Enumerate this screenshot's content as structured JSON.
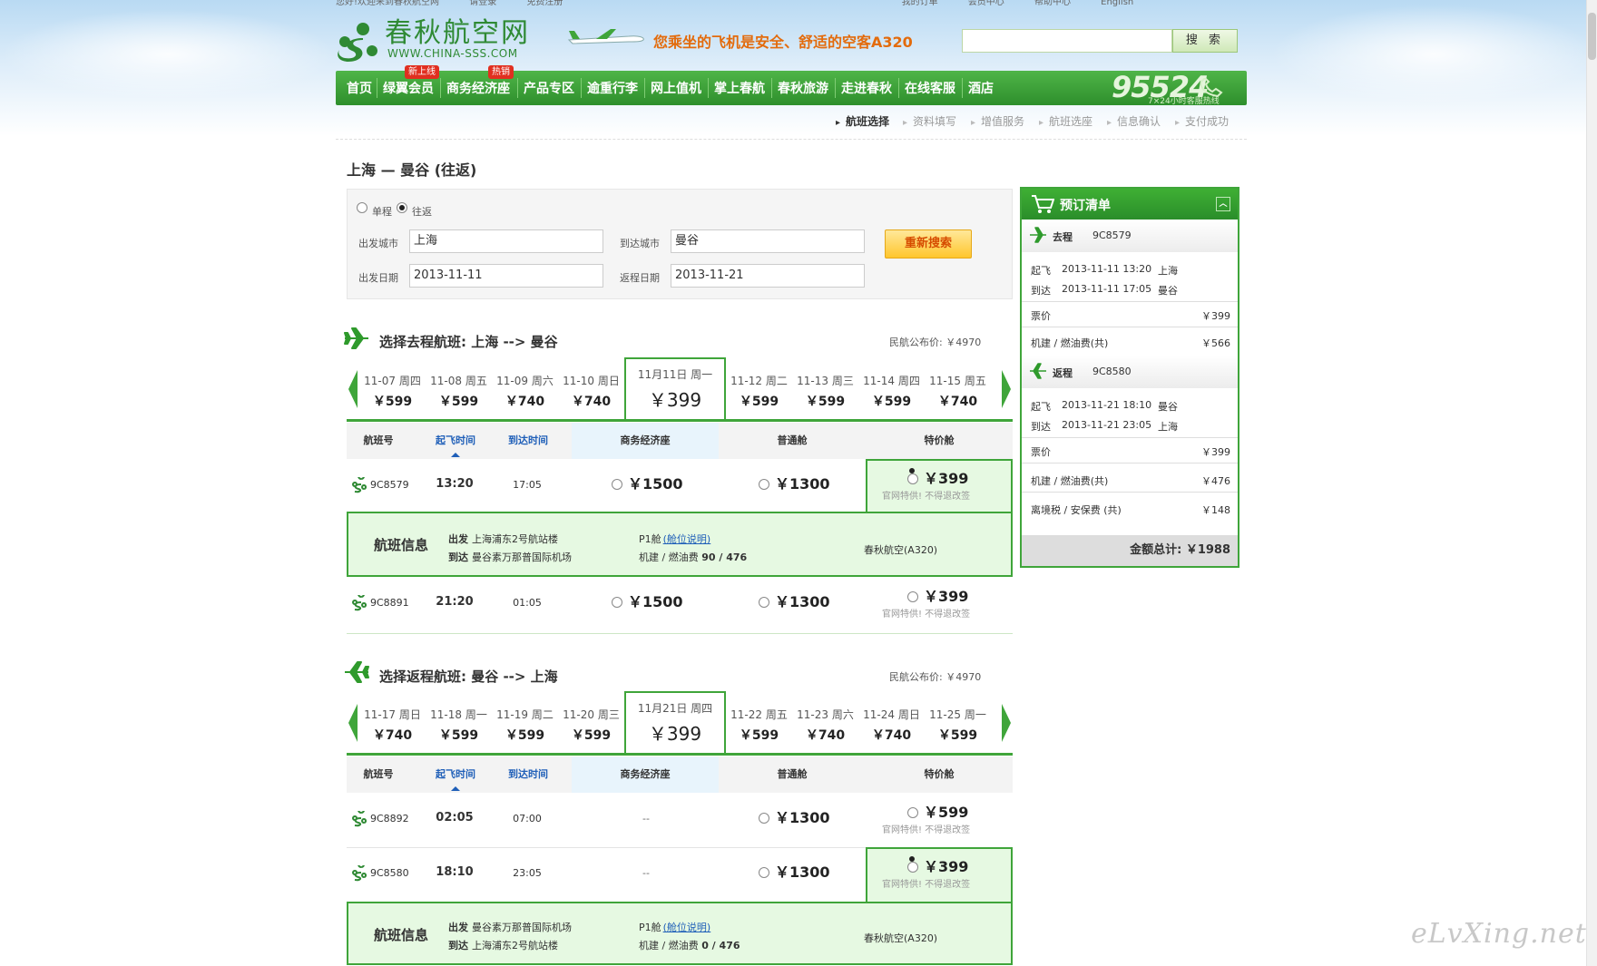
{
  "topbar": {
    "items": [
      "您好!欢迎来到春秋航空网",
      "请登录",
      "免费注册",
      "我的订单",
      "会员中心",
      "帮助中心",
      "English"
    ]
  },
  "logo": {
    "name": "春秋航空网",
    "url": "WWW.CHINA-SSS.COM"
  },
  "banner": {
    "text": "您乘坐的飞机是安全、舒适的空客A320"
  },
  "search": {
    "placeholder": "",
    "button": "搜 索"
  },
  "nav": {
    "items": [
      {
        "label": "首页",
        "badge": ""
      },
      {
        "label": "绿翼会员",
        "badge": "新上线"
      },
      {
        "label": "商务经济座",
        "badge": "热销"
      },
      {
        "label": "产品专区",
        "badge": ""
      },
      {
        "label": "逾重行李",
        "badge": ""
      },
      {
        "label": "网上值机",
        "badge": ""
      },
      {
        "label": "掌上春航",
        "badge": ""
      },
      {
        "label": "春秋旅游",
        "badge": ""
      },
      {
        "label": "走进春秋",
        "badge": ""
      },
      {
        "label": "在线客服",
        "badge": ""
      },
      {
        "label": "酒店",
        "badge": ""
      }
    ],
    "hotline": {
      "number": "95524",
      "subtitle": "7×24小时客服热线"
    }
  },
  "steps": [
    "航班选择",
    "资料填写",
    "增值服务",
    "航班选座",
    "信息确认",
    "支付成功"
  ],
  "route": {
    "title": "上海 — 曼谷 (往返)"
  },
  "search_form": {
    "trip_types": [
      "单程",
      "往返"
    ],
    "selected_trip": "往返",
    "depart_city_label": "出发城市",
    "depart_city": "上海",
    "arrive_city_label": "到达城市",
    "arrive_city": "曼谷",
    "depart_date_label": "出发日期",
    "depart_date": "2013-11-11",
    "return_date_label": "返程日期",
    "return_date": "2013-11-21",
    "research_button": "重新搜索"
  },
  "outbound": {
    "title": "选择去程航班: 上海 --> 曼谷",
    "published_price": "民航公布价: ￥4970",
    "dates": [
      {
        "date": "11-07 周四",
        "price": "￥599"
      },
      {
        "date": "11-08 周五",
        "price": "￥599"
      },
      {
        "date": "11-09 周六",
        "price": "￥740"
      },
      {
        "date": "11-10 周日",
        "price": "￥740"
      },
      {
        "date": "11月11日 周一",
        "price": "￥399",
        "selected": true
      },
      {
        "date": "11-12 周二",
        "price": "￥599"
      },
      {
        "date": "11-13 周三",
        "price": "￥599"
      },
      {
        "date": "11-14 周四",
        "price": "￥599"
      },
      {
        "date": "11-15 周五",
        "price": "￥740"
      }
    ],
    "flights": [
      {
        "flight_no": "9C8579",
        "dep": "13:20",
        "arr": "17:05",
        "business": "￥1500",
        "economy": "￥1300",
        "special": "￥399",
        "special_note": "官网特供! 不得退改签",
        "selected": "special"
      },
      {
        "flight_no": "9C8891",
        "dep": "21:20",
        "arr": "01:05",
        "business": "￥1500",
        "economy": "￥1300",
        "special": "￥399",
        "special_note": "官网特供! 不得退改签",
        "selected": ""
      }
    ],
    "info": {
      "title": "航班信息",
      "depart_label": "出发",
      "depart": "上海浦东2号航站楼",
      "arrive_label": "到达",
      "arrive": "曼谷素万那普国际机场",
      "cabin": "P1舱",
      "cabin_link": "(舱位说明)",
      "fee_label": "机建 / 燃油费",
      "fee": "90 / 476",
      "aircraft": "春秋航空(A320)"
    }
  },
  "table_headers": {
    "flight_no": "航班号",
    "dep": "起飞时间",
    "arr": "到达时间",
    "business": "商务经济座",
    "economy": "普通舱",
    "special": "特价舱"
  },
  "inbound": {
    "title": "选择返程航班: 曼谷 --> 上海",
    "published_price": "民航公布价: ￥4970",
    "dates": [
      {
        "date": "11-17 周日",
        "price": "￥740"
      },
      {
        "date": "11-18 周一",
        "price": "￥599"
      },
      {
        "date": "11-19 周二",
        "price": "￥599"
      },
      {
        "date": "11-20 周三",
        "price": "￥599"
      },
      {
        "date": "11月21日 周四",
        "price": "￥399",
        "selected": true
      },
      {
        "date": "11-22 周五",
        "price": "￥599"
      },
      {
        "date": "11-23 周六",
        "price": "￥740"
      },
      {
        "date": "11-24 周日",
        "price": "￥740"
      },
      {
        "date": "11-25 周一",
        "price": "￥599"
      }
    ],
    "flights": [
      {
        "flight_no": "9C8892",
        "dep": "02:05",
        "arr": "07:00",
        "business": "--",
        "economy": "￥1300",
        "special": "￥599",
        "special_note": "官网特供! 不得退改签",
        "selected": ""
      },
      {
        "flight_no": "9C8580",
        "dep": "18:10",
        "arr": "23:05",
        "business": "--",
        "economy": "￥1300",
        "special": "￥399",
        "special_note": "官网特供! 不得退改签",
        "selected": "special"
      }
    ],
    "info": {
      "title": "航班信息",
      "depart_label": "出发",
      "depart": "曼谷素万那普国际机场",
      "arrive_label": "到达",
      "arrive": "上海浦东2号航站楼",
      "cabin": "P1舱",
      "cabin_link": "(舱位说明)",
      "fee_label": "机建 / 燃油费",
      "fee": "0 / 476",
      "aircraft": "春秋航空(A320)"
    }
  },
  "cart": {
    "title": "预订清单",
    "outbound": {
      "label": "去程",
      "flight_no": "9C8579",
      "takeoff_label": "起飞",
      "takeoff_time": "2013-11-11 13:20",
      "takeoff_city": "上海",
      "arrive_label": "到达",
      "arrive_time": "2013-11-11 17:05",
      "arrive_city": "曼谷",
      "fare_label": "票价",
      "fare": "￥399",
      "tax_label": "机建 / 燃油费(共)",
      "tax": "￥566"
    },
    "inbound": {
      "label": "返程",
      "flight_no": "9C8580",
      "takeoff_label": "起飞",
      "takeoff_time": "2013-11-21 18:10",
      "takeoff_city": "曼谷",
      "arrive_label": "到达",
      "arrive_time": "2013-11-21 23:05",
      "arrive_city": "上海",
      "fare_label": "票价",
      "fare": "￥399",
      "tax_label": "机建 / 燃油费(共)",
      "tax": "￥476",
      "extra_label": "离境税 / 安保费 (共)",
      "extra": "￥148"
    },
    "total_label": "金额总计:",
    "total": "￥1988"
  },
  "watermark": "eLvXing.net",
  "colors": {
    "brand_green": "#3fa53a",
    "nav_green": "#2e8f2c",
    "banner_orange": "#e36b0c",
    "link_blue": "#1f5fb8",
    "select_bg": "#e6f9e2"
  }
}
